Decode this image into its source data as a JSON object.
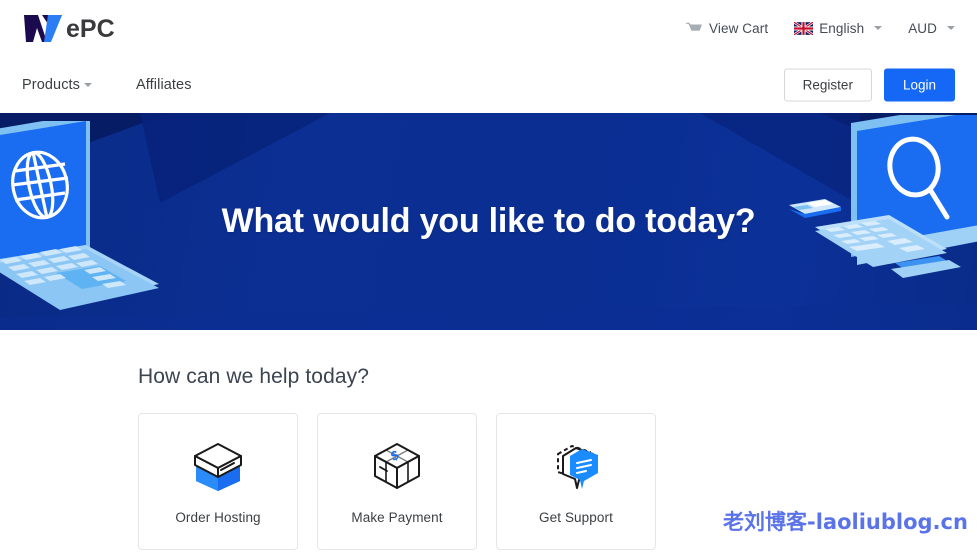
{
  "brand": {
    "logo_text": "WePC",
    "logo_mark_w": "W",
    "logo_word": "ePC",
    "logo_dark_color": "#1b0b4e",
    "logo_blue_color": "#2a7df5",
    "logo_text_color": "#3a3a3c"
  },
  "utility_bar": {
    "cart": {
      "label": "View Cart",
      "icon": "shopping-cart-icon"
    },
    "language": {
      "label": "English",
      "icon": "uk-flag-icon",
      "caret": "chevron-down-icon"
    },
    "currency": {
      "label": "AUD",
      "caret": "chevron-down-icon"
    }
  },
  "main_nav": {
    "items": [
      {
        "label": "Products",
        "has_caret": true
      },
      {
        "label": "Affiliates",
        "has_caret": false
      }
    ],
    "register_label": "Register",
    "login_label": "Login",
    "primary_color": "#1567f5"
  },
  "hero": {
    "title": "What would you like to do today?",
    "background_color": "#0a2e91",
    "left_illustration": "isometric-laptop-globe-illustration",
    "right_illustration": "isometric-desktop-search-illustration"
  },
  "help_section": {
    "heading": "How can we help today?",
    "cards": [
      {
        "label": "Order Hosting",
        "icon": "stacked-box-icon"
      },
      {
        "label": "Make Payment",
        "icon": "dollar-box-icon"
      },
      {
        "label": "Get Support",
        "icon": "chat-bubble-icon"
      }
    ]
  },
  "watermark": {
    "text": "老刘博客-laoliublog.cn",
    "color": "#5b73e8"
  }
}
